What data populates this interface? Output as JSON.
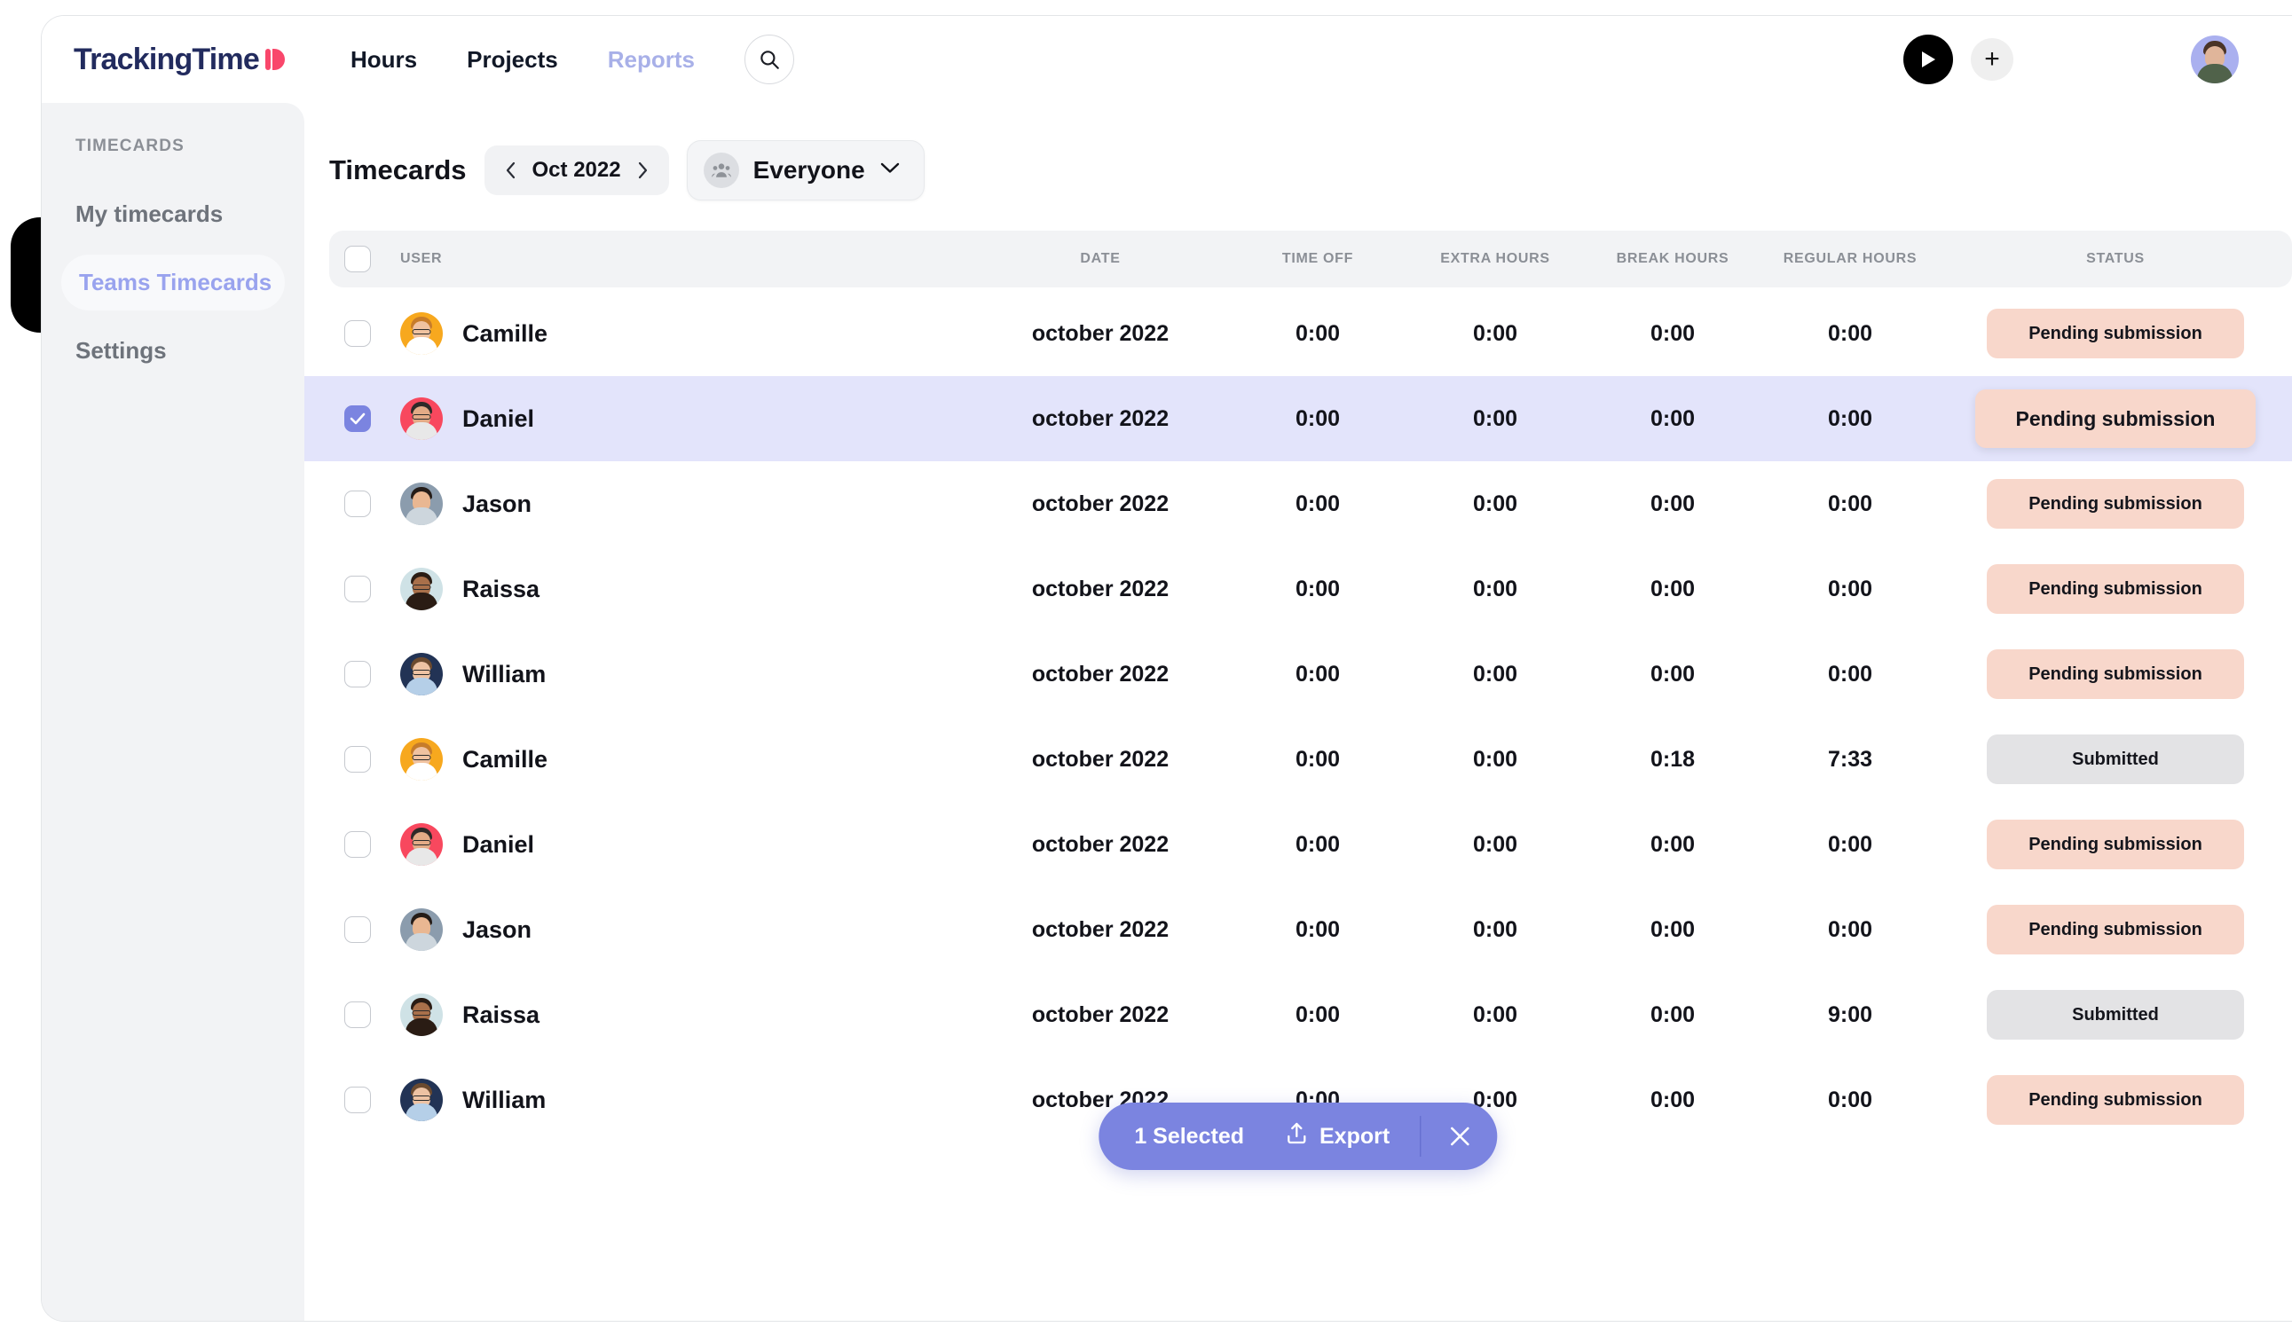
{
  "brand": {
    "name": "TrackingTime",
    "logo_mark": "play-mark-icon",
    "color": "#222b5e",
    "accent": "#f9476b"
  },
  "topnav": {
    "links": [
      {
        "label": "Hours",
        "active": true
      },
      {
        "label": "Projects",
        "active": true
      },
      {
        "label": "Reports",
        "active": false
      }
    ],
    "search_icon": "search-icon",
    "play_icon": "play-icon",
    "add_icon": "plus-icon",
    "avatar_icon": "user-avatar"
  },
  "sidebar": {
    "heading": "TIMECARDS",
    "items": [
      {
        "label": "My timecards",
        "active": false
      },
      {
        "label": "Teams Timecards",
        "active": true
      },
      {
        "label": "Settings",
        "active": false
      }
    ],
    "active_color": "#99a3ee"
  },
  "content_header": {
    "title": "Timecards",
    "month": "Oct 2022",
    "prev_icon": "chevron-left-icon",
    "next_icon": "chevron-right-icon",
    "team_filter": "Everyone",
    "team_icon": "people-group-icon",
    "team_chevron": "chevron-down-icon"
  },
  "table": {
    "columns": [
      "USER",
      "DATE",
      "TIME OFF",
      "EXTRA HOURS",
      "BREAK HOURS",
      "REGULAR HOURS",
      "STATUS"
    ],
    "rows": [
      {
        "user": "Camille",
        "avatar_bg": "#f7a81e",
        "hair": "#c77c2a",
        "skin": "#f0c2a0",
        "shirt": "#ffffff",
        "glasses": true,
        "date": "october 2022",
        "time_off": "0:00",
        "extra_hours": "0:00",
        "break_hours": "0:00",
        "regular_hours": "0:00",
        "status": "Pending submission",
        "status_kind": "pending",
        "selected": false
      },
      {
        "user": "Daniel",
        "avatar_bg": "#f8485e",
        "hair": "#2e2a28",
        "skin": "#e3ab86",
        "shirt": "#e8e8e8",
        "glasses": true,
        "date": "october 2022",
        "time_off": "0:00",
        "extra_hours": "0:00",
        "break_hours": "0:00",
        "regular_hours": "0:00",
        "status": "Pending submission",
        "status_kind": "pending",
        "selected": true
      },
      {
        "user": "Jason",
        "avatar_bg": "#8b9cad",
        "hair": "#241c18",
        "skin": "#e9b792",
        "shirt": "#cdd6dd",
        "glasses": false,
        "date": "october 2022",
        "time_off": "0:00",
        "extra_hours": "0:00",
        "break_hours": "0:00",
        "regular_hours": "0:00",
        "status": "Pending submission",
        "status_kind": "pending",
        "selected": false
      },
      {
        "user": "Raissa",
        "avatar_bg": "#cfe2e6",
        "hair": "#2a1c14",
        "skin": "#a9704a",
        "shirt": "#2a1c14",
        "glasses": true,
        "date": "october 2022",
        "time_off": "0:00",
        "extra_hours": "0:00",
        "break_hours": "0:00",
        "regular_hours": "0:00",
        "status": "Pending submission",
        "status_kind": "pending",
        "selected": false
      },
      {
        "user": "William",
        "avatar_bg": "#223355",
        "hair": "#6b4a2f",
        "skin": "#edc2a3",
        "shirt": "#b5cfe8",
        "glasses": true,
        "date": "october 2022",
        "time_off": "0:00",
        "extra_hours": "0:00",
        "break_hours": "0:00",
        "regular_hours": "0:00",
        "status": "Pending submission",
        "status_kind": "pending",
        "selected": false
      },
      {
        "user": "Camille",
        "avatar_bg": "#f7a81e",
        "hair": "#c77c2a",
        "skin": "#f0c2a0",
        "shirt": "#ffffff",
        "glasses": true,
        "date": "october 2022",
        "time_off": "0:00",
        "extra_hours": "0:00",
        "break_hours": "0:18",
        "regular_hours": "7:33",
        "status": "Submitted",
        "status_kind": "submitted",
        "selected": false
      },
      {
        "user": "Daniel",
        "avatar_bg": "#f8485e",
        "hair": "#2e2a28",
        "skin": "#e3ab86",
        "shirt": "#e8e8e8",
        "glasses": true,
        "date": "october 2022",
        "time_off": "0:00",
        "extra_hours": "0:00",
        "break_hours": "0:00",
        "regular_hours": "0:00",
        "status": "Pending submission",
        "status_kind": "pending",
        "selected": false
      },
      {
        "user": "Jason",
        "avatar_bg": "#8b9cad",
        "hair": "#241c18",
        "skin": "#e9b792",
        "shirt": "#cdd6dd",
        "glasses": false,
        "date": "october 2022",
        "time_off": "0:00",
        "extra_hours": "0:00",
        "break_hours": "0:00",
        "regular_hours": "0:00",
        "status": "Pending submission",
        "status_kind": "pending",
        "selected": false
      },
      {
        "user": "Raissa",
        "avatar_bg": "#cfe2e6",
        "hair": "#2a1c14",
        "skin": "#a9704a",
        "shirt": "#2a1c14",
        "glasses": true,
        "date": "october 2022",
        "time_off": "0:00",
        "extra_hours": "0:00",
        "break_hours": "0:00",
        "regular_hours": "9:00",
        "status": "Submitted",
        "status_kind": "submitted",
        "selected": false
      },
      {
        "user": "William",
        "avatar_bg": "#223355",
        "hair": "#6b4a2f",
        "skin": "#edc2a3",
        "shirt": "#b5cfe8",
        "glasses": true,
        "date": "october 2022",
        "time_off": "0:00",
        "extra_hours": "0:00",
        "break_hours": "0:00",
        "regular_hours": "0:00",
        "status": "Pending submission",
        "status_kind": "pending",
        "selected": false
      }
    ]
  },
  "selection_bar": {
    "count_label": "1 Selected",
    "export_label": "Export",
    "export_icon": "upload-icon",
    "close_icon": "close-icon",
    "color": "#7b84e0"
  },
  "colors": {
    "pending_badge": "#f8d7cb",
    "submitted_badge": "#e3e3e5",
    "selected_row": "#e3e4fb",
    "sidebar_bg": "#f2f3f5",
    "checkbox_checked": "#7b84e0"
  }
}
